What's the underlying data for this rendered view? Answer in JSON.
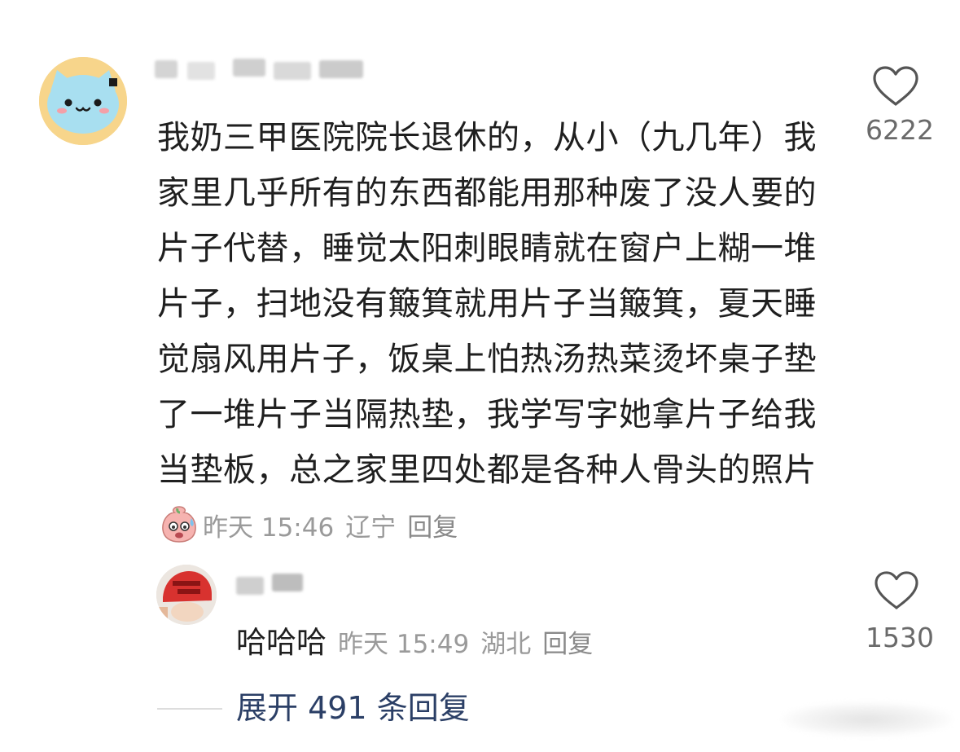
{
  "main_comment": {
    "username": "",
    "avatar": "blue-cat-face-avatar",
    "text": "我奶三甲医院院长退休的，从小（九几年）我家里几乎所有的东西都能用那种废了没人要的片子代替，睡觉太阳刺眼睛就在窗户上糊一堆片子，扫地没有簸箕就用片子当簸箕，夏天睡觉扇风用片子，饭桌上怕热汤热菜烫坏桌子垫了一堆片子当隔热垫，我学写字她拿片子给我当垫板，总之家里四处都是各种人骨头的照片",
    "emoji": "sweating-peach-face-icon",
    "time": "昨天 15:46",
    "location": "辽宁",
    "reply_label": "回复",
    "likes": "6222"
  },
  "reply_comment": {
    "username": "",
    "avatar": "red-cap-avatar",
    "text": "哈哈哈",
    "time": "昨天 15:49",
    "location": "湖北",
    "reply_label": "回复",
    "likes": "1530"
  },
  "expand": {
    "label": "展开 491 条回复"
  },
  "colors": {
    "text": "#1f1f1f",
    "meta": "#9a9a9a",
    "link": "#2b3f66",
    "avatar_bg": "#f7d58b",
    "cat_blue": "#a8dff0"
  }
}
